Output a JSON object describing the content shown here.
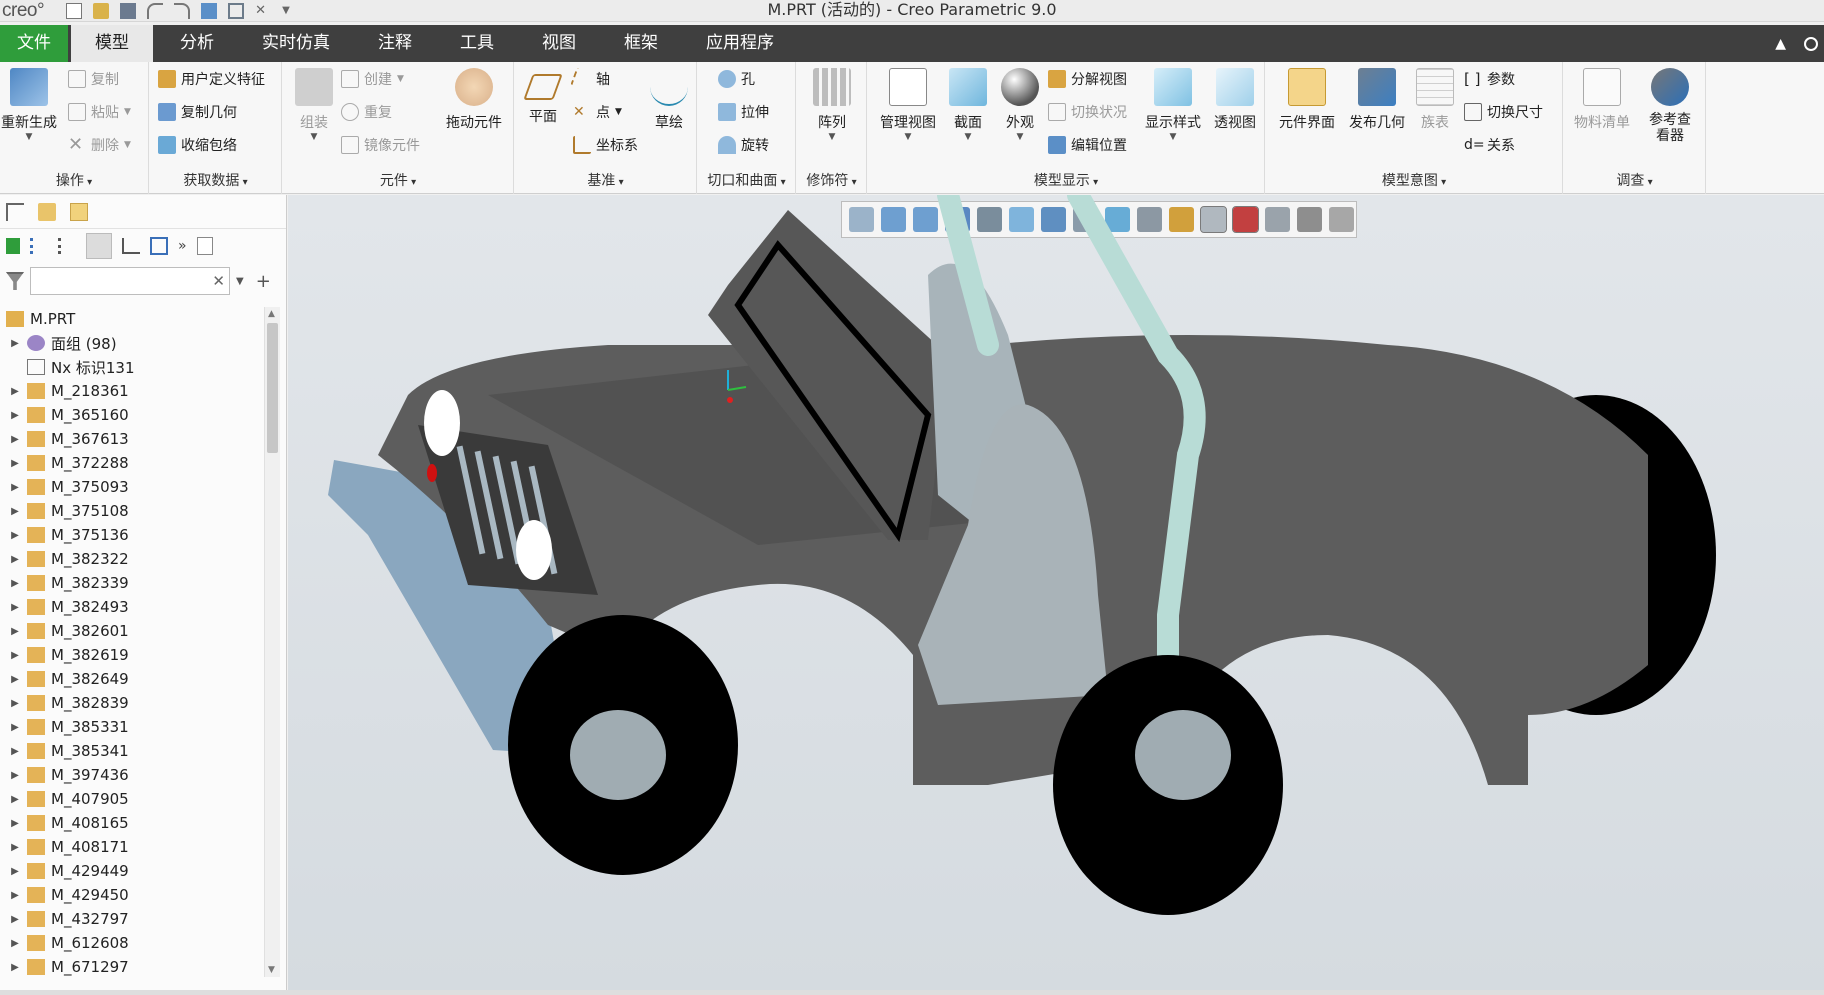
{
  "app": {
    "logo": "creo°",
    "window_title": "M.PRT (活动的) - Creo Parametric 9.0"
  },
  "menu": {
    "tabs": [
      "文件",
      "模型",
      "分析",
      "实时仿真",
      "注释",
      "工具",
      "视图",
      "框架",
      "应用程序"
    ],
    "active": "模型"
  },
  "ribbon": {
    "operations": {
      "label": "操作",
      "regen": "重新生成",
      "copy": "复制",
      "paste": "粘贴",
      "delete": "删除"
    },
    "get_data": {
      "label": "获取数据",
      "udf": "用户定义特征",
      "copy_geom": "复制几何",
      "shrinkwrap": "收缩包络"
    },
    "component": {
      "label": "元件",
      "assemble": "组装",
      "create": "创建",
      "repeat": "重复",
      "mirror": "镜像元件",
      "drag": "拖动元件"
    },
    "datum": {
      "label": "基准",
      "plane": "平面",
      "axis": "轴",
      "point": "点",
      "csys": "坐标系",
      "sketch": "草绘"
    },
    "cut_surface": {
      "label": "切口和曲面",
      "hole": "孔",
      "extrude": "拉伸",
      "revolve": "旋转"
    },
    "modifiers": {
      "label": "修饰符",
      "pattern": "阵列"
    },
    "model_display": {
      "label": "模型显示",
      "manage_views": "管理视图",
      "section": "截面",
      "appearance": "外观",
      "explode": "分解视图",
      "toggle_status": "切换状况",
      "edit_position": "编辑位置",
      "display_style": "显示样式",
      "perspective": "透视图"
    },
    "model_intent": {
      "label": "模型意图",
      "component_interface": "元件界面",
      "publish_geom": "发布几何",
      "family_table": "族表",
      "parameters": "参数",
      "switch_dims": "切换尺寸",
      "relations": "关系"
    },
    "investigate": {
      "label": "调查",
      "bom": "物料清单",
      "ref_viewer": "参考查看器"
    }
  },
  "tree": {
    "search_placeholder": "",
    "root": "M.PRT",
    "items": [
      "面组 (98)",
      "Nx 标识131",
      "M_218361",
      "M_365160",
      "M_367613",
      "M_372288",
      "M_375093",
      "M_375108",
      "M_375136",
      "M_382322",
      "M_382339",
      "M_382493",
      "M_382601",
      "M_382619",
      "M_382649",
      "M_382839",
      "M_385331",
      "M_385341",
      "M_397436",
      "M_407905",
      "M_408165",
      "M_408171",
      "M_429449",
      "M_429450",
      "M_432797",
      "M_612608",
      "M_671297"
    ]
  },
  "icons": {
    "graph_toolbar": [
      "refit-icon",
      "zoom-in-icon",
      "zoom-out-icon",
      "repaint-icon",
      "display-style-icon",
      "saved-orientations-icon",
      "view-manager-icon",
      "perspective-icon",
      "section-icon",
      "datum-display-icon",
      "annotation-display-icon",
      "spin-center-icon",
      "model-tree-toggle-icon",
      "warning-icon",
      "pause-icon",
      "next-icon"
    ]
  }
}
